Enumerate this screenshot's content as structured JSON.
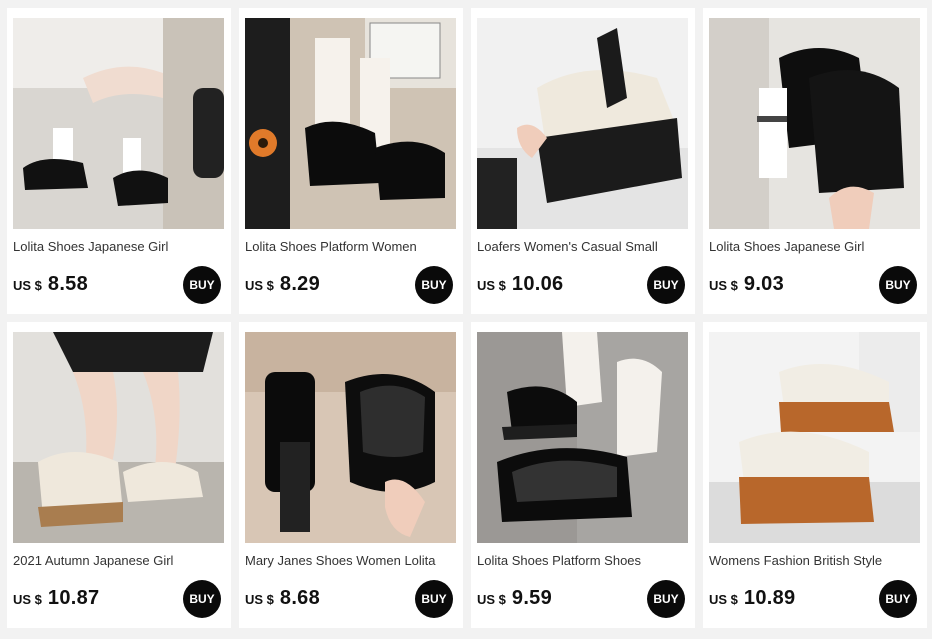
{
  "products": [
    {
      "title": "Lolita Shoes Japanese Girl",
      "currency": "US $",
      "price": "8.58",
      "buy_label": "BUY",
      "image": "black-platform-mary-jane-with-white-socks"
    },
    {
      "title": "Lolita Shoes Platform Women",
      "currency": "US $",
      "price": "8.29",
      "buy_label": "BUY",
      "image": "black-buckle-mary-jane-with-frilly-socks"
    },
    {
      "title": "Loafers Women's Casual Small",
      "currency": "US $",
      "price": "10.06",
      "buy_label": "BUY",
      "image": "cream-lace-up-platform-oxford-in-hand"
    },
    {
      "title": "Lolita Shoes Japanese Girl",
      "currency": "US $",
      "price": "9.03",
      "buy_label": "BUY",
      "image": "black-mary-jane-pair-with-socks-in-hand"
    },
    {
      "title": "2021 Autumn Japanese Girl",
      "currency": "US $",
      "price": "10.87",
      "buy_label": "BUY",
      "image": "cream-lace-up-loafers-worn-with-skirt"
    },
    {
      "title": "Mary Janes Shoes Women Lolita",
      "currency": "US $",
      "price": "8.68",
      "buy_label": "BUY",
      "image": "glossy-black-mary-janes-held-in-hand"
    },
    {
      "title": "Lolita Shoes Platform Shoes",
      "currency": "US $",
      "price": "9.59",
      "buy_label": "BUY",
      "image": "black-mary-janes-with-white-socks-on-marble"
    },
    {
      "title": "Womens Fashion British Style",
      "currency": "US $",
      "price": "10.89",
      "buy_label": "BUY",
      "image": "white-and-tan-chunky-platform-oxfords"
    }
  ]
}
